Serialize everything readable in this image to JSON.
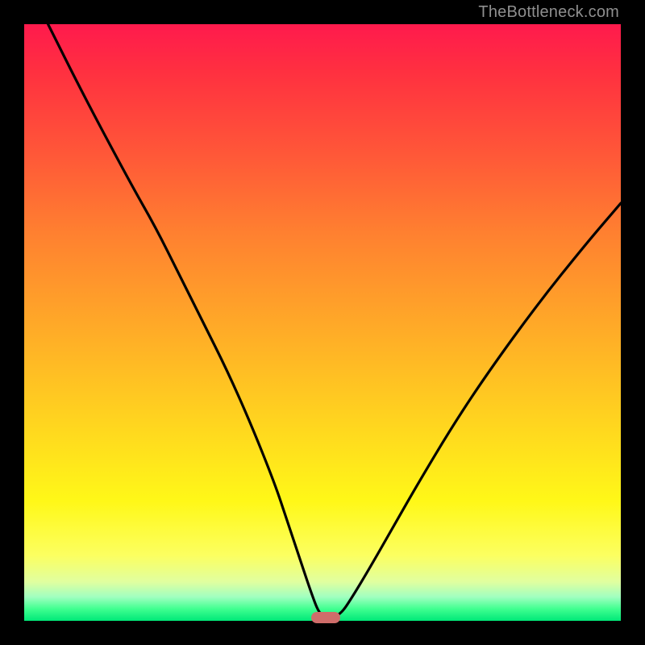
{
  "watermark": "TheBottleneck.com",
  "colors": {
    "frame": "#000000",
    "gradient_top": "#ff1a4d",
    "gradient_bottom": "#00e878",
    "curve": "#000000",
    "marker": "#cf6d6a",
    "watermark_text": "#8f8f8f"
  },
  "chart_data": {
    "type": "line",
    "title": "",
    "xlabel": "",
    "ylabel": "",
    "xlim": [
      0,
      100
    ],
    "ylim": [
      0,
      100
    ],
    "grid": false,
    "legend": false,
    "series": [
      {
        "name": "bottleneck-curve",
        "x": [
          4,
          10,
          18,
          22,
          26,
          30,
          34,
          38,
          42,
          44,
          46,
          48,
          49.5,
          51,
          53,
          55,
          58,
          62,
          66,
          72,
          78,
          86,
          94,
          100
        ],
        "values": [
          100,
          88,
          73,
          66,
          58,
          50,
          42,
          33,
          23,
          17,
          11,
          5,
          1,
          0.5,
          1,
          4,
          9,
          16,
          23,
          33,
          42,
          53,
          63,
          70
        ]
      }
    ],
    "marker": {
      "x": 50.5,
      "y": 0.5
    },
    "background_gradient": {
      "direction": "vertical",
      "stops": [
        {
          "pos": 0,
          "color": "#ff1a4d"
        },
        {
          "pos": 0.35,
          "color": "#ff8030"
        },
        {
          "pos": 0.65,
          "color": "#ffd020"
        },
        {
          "pos": 0.89,
          "color": "#fcff60"
        },
        {
          "pos": 1.0,
          "color": "#00e878"
        }
      ]
    }
  }
}
